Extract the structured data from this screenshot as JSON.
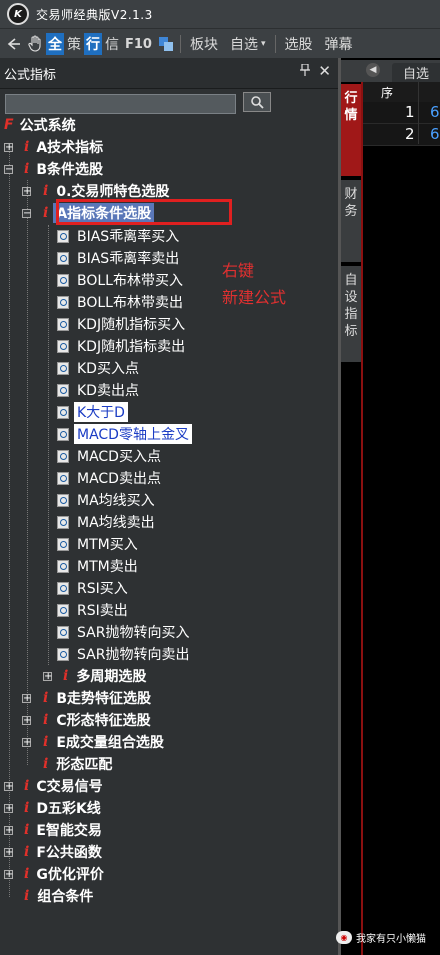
{
  "app": {
    "logo_text": "K",
    "title": "交易师经典版V2.1.3"
  },
  "toolbar": {
    "back_icon": "arrow-left-icon",
    "hand_icon": "hand-icon",
    "items": [
      "全",
      "策",
      "行",
      "信",
      "F10"
    ],
    "layout_icon": "window-layout-icon",
    "menus": [
      "板块",
      "自选",
      "选股",
      "弹幕"
    ],
    "zixuan_arrow": "▾"
  },
  "panel": {
    "title": "公式指标",
    "pin": "📌",
    "close": "✕",
    "search_placeholder": ""
  },
  "tree": {
    "root": "公式系统",
    "A": "A技术指标",
    "B": "B条件选股",
    "B0": "0.交易师特色选股",
    "BA": "A指标条件选股",
    "leaves": [
      "BIAS乖离率买入",
      "BIAS乖离率卖出",
      "BOLL布林带买入",
      "BOLL布林带卖出",
      "KDJ随机指标买入",
      "KDJ随机指标卖出",
      "KD买入点",
      "KD卖出点",
      "K大于D",
      "MACD零轴上金叉",
      "MACD买入点",
      "MACD卖出点",
      "MA均线买入",
      "MA均线卖出",
      "MTM买入",
      "MTM卖出",
      "RSI买入",
      "RSI卖出",
      "SAR抛物转向买入",
      "SAR抛物转向卖出"
    ],
    "multi": "多周期选股",
    "Btrend": "B走势特征选股",
    "Cshape": "C形态特征选股",
    "Evol": "E成交量组合选股",
    "shape_match": "形态匹配",
    "C": "C交易信号",
    "D": "D五彩K线",
    "E": "E智能交易",
    "F": "F公共函数",
    "G": "G优化评价",
    "combo": "组合条件"
  },
  "annotation": {
    "line1": "右键",
    "line2": "新建公式"
  },
  "right": {
    "tab_label": "自选",
    "side_tabs": [
      [
        "行",
        "情"
      ],
      [
        "财",
        "务"
      ],
      [
        "自",
        "设",
        "指",
        "标"
      ]
    ],
    "col_header": "序",
    "rows": [
      {
        "no": "1",
        "val": "6"
      },
      {
        "no": "2",
        "val": "6"
      }
    ]
  },
  "watermark": "我家有只小懒猫",
  "colors": {
    "accent_red": "#e0302a",
    "selection_blue": "#5a77b8",
    "link_blue": "#1b3cc4"
  }
}
